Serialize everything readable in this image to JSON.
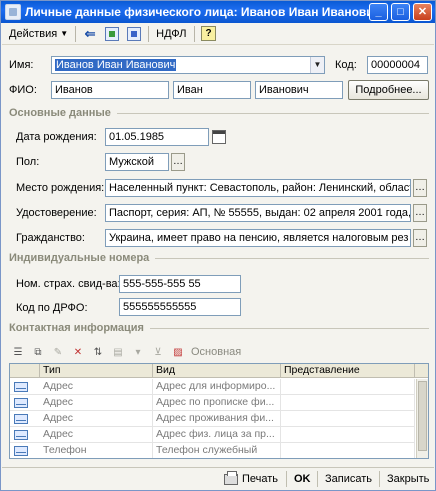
{
  "window": {
    "title": "Личные данные физического лица: Иванов Иван Иванович",
    "min_glyph": "_",
    "max_glyph": "□",
    "close_glyph": "✕"
  },
  "toolbar": {
    "actions_label": "Действия",
    "ndfl_label": "НДФЛ",
    "help_glyph": "?"
  },
  "person": {
    "name_label": "Имя:",
    "name_value": "Иванов Иван Иванович",
    "code_label": "Код:",
    "code_value": "00000004",
    "fio_label": "ФИО:",
    "last_name": "Иванов",
    "first_name": "Иван",
    "middle_name": "Иванович",
    "details_button": "Подробнее..."
  },
  "basic": {
    "section_title": "Основные данные",
    "birthdate_label": "Дата рождения:",
    "birthdate_value": "01.05.1985",
    "sex_label": "Пол:",
    "sex_value": "Мужской",
    "birthplace_label": "Место рождения:",
    "birthplace_value": "Населенный пункт: Севастополь, район:  Ленинский, област",
    "id_label": "Удостоверение:",
    "id_value": "Паспорт, серия: АП, № 55555, выдан: 02 апреля 2001 года,",
    "citizenship_label": "Гражданство:",
    "citizenship_value": "Украина, имеет право на пенсию, является налоговым рез"
  },
  "ids": {
    "section_title": "Индивидуальные номера",
    "insurance_label": "Ном. страх. свид-ва:",
    "insurance_value": "555-555-555 55",
    "drfo_label": "Код по ДРФО:",
    "drfo_value": "555555555555"
  },
  "contacts": {
    "section_title": "Контактная информация",
    "main_label": "Основная",
    "columns": [
      "Тип",
      "Вид",
      "Представление"
    ],
    "rows": [
      {
        "type": "Адрес",
        "kind": "Адрес для информиро...",
        "repr": ""
      },
      {
        "type": "Адрес",
        "kind": "Адрес по прописке фи...",
        "repr": ""
      },
      {
        "type": "Адрес",
        "kind": "Адрес проживания фи...",
        "repr": ""
      },
      {
        "type": "Адрес",
        "kind": "Адрес физ. лица за пр...",
        "repr": ""
      },
      {
        "type": "Телефон",
        "kind": "Телефон служебный",
        "repr": ""
      }
    ]
  },
  "bottom": {
    "print_label": "Печать",
    "ok_label": "OK",
    "save_label": "Записать",
    "close_label": "Закрыть"
  }
}
